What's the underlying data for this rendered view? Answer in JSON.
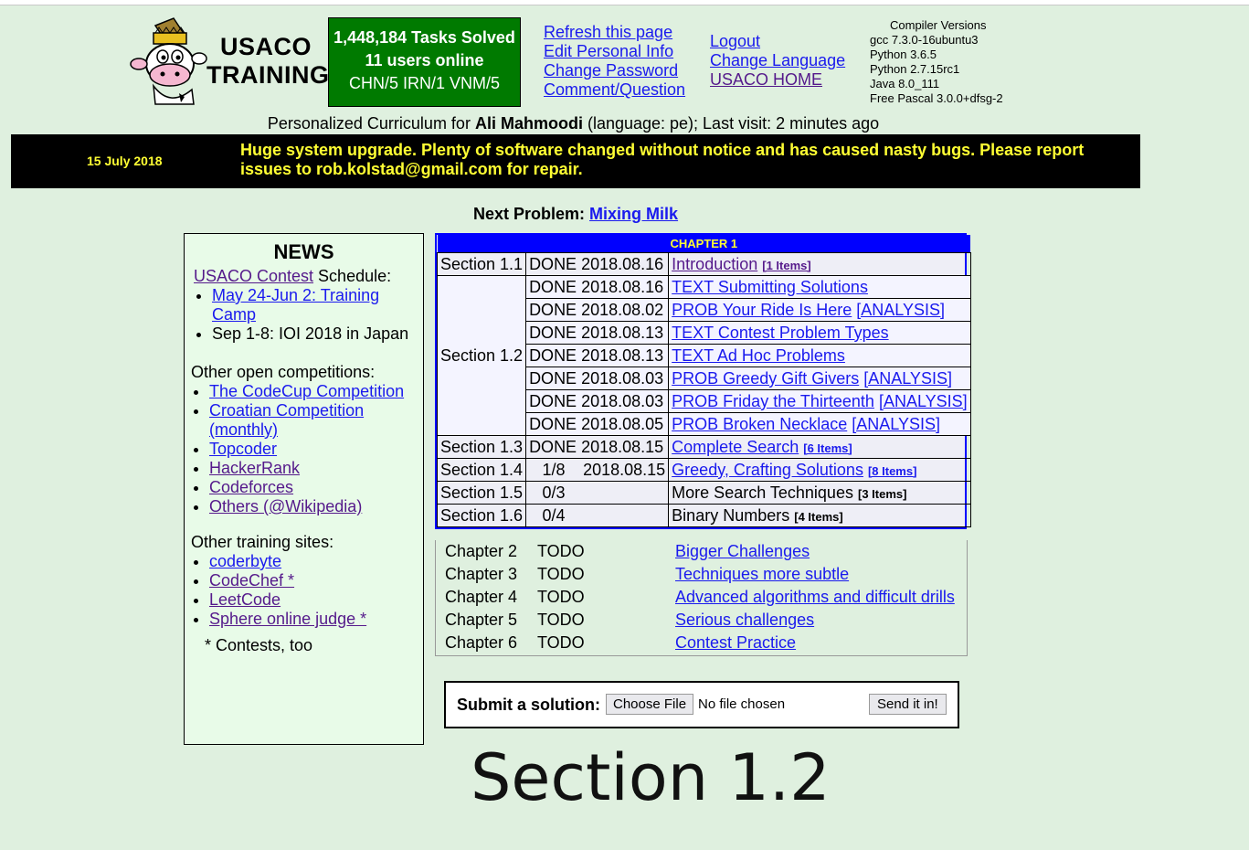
{
  "logo": {
    "line1": "USACO",
    "line2": "TRAINING"
  },
  "stats": {
    "tasks": "1,448,184 Tasks Solved",
    "users": "11 users online",
    "countries": "CHN/5 IRN/1 VNM/5"
  },
  "links_left": [
    "Refresh this page",
    "Edit Personal Info",
    "Change Password",
    "Comment/Question"
  ],
  "links_right": [
    "Logout",
    "Change Language",
    "USACO HOME"
  ],
  "compiler": {
    "title": "Compiler Versions",
    "versions": [
      "gcc 7.3.0-16ubuntu3",
      "Python 3.6.5",
      "Python 2.7.15rc1",
      "Java 8.0_111",
      "Free Pascal 3.0.0+dfsg-2"
    ]
  },
  "curriculum": {
    "prefix": "Personalized Curriculum for ",
    "name": "Ali Mahmoodi",
    "suffix": " (language: pe); Last visit: 2 minutes ago"
  },
  "banner": {
    "date": "15 July 2018",
    "message": "Huge system upgrade. Plenty of software changed without notice and has caused nasty bugs. Please report issues to rob.kolstad@gmail.com for repair."
  },
  "next_problem": {
    "label": "Next Problem:",
    "link": "Mixing Milk"
  },
  "news": {
    "title": "NEWS",
    "contest_link": "USACO Contest",
    "contest_suffix": " Schedule:",
    "schedule_link": "May 24-Jun 2: Training Camp",
    "schedule_text": "Sep 1-8: IOI 2018 in Japan",
    "open_title": "Other open competitions:",
    "open_links": [
      "The CodeCup Competition",
      "Croatian Competition (monthly)",
      "Topcoder",
      "HackerRank",
      "Codeforces",
      "Others (@Wikipedia)"
    ],
    "training_title": "Other training sites:",
    "training_links": [
      "coderbyte",
      "CodeChef *",
      "LeetCode",
      "Sphere online judge *"
    ],
    "footnote": "* Contests, too"
  },
  "chapter1": {
    "header": "CHAPTER 1",
    "s11": {
      "section": "Section 1.1",
      "status": "DONE 2018.08.16",
      "title": "Introduction",
      "items": "[1 Items]"
    },
    "s12": {
      "section": "Section 1.2",
      "rows": [
        {
          "status": "DONE 2018.08.16",
          "title": "TEXT Submitting Solutions",
          "analysis": ""
        },
        {
          "status": "DONE 2018.08.02",
          "title": "PROB Your Ride Is Here",
          "analysis": "[ANALYSIS]"
        },
        {
          "status": "DONE 2018.08.13",
          "title": "TEXT Contest Problem Types",
          "analysis": ""
        },
        {
          "status": "DONE 2018.08.13",
          "title": "TEXT Ad Hoc Problems",
          "analysis": ""
        },
        {
          "status": "DONE 2018.08.03",
          "title": "PROB Greedy Gift Givers",
          "analysis": "[ANALYSIS]"
        },
        {
          "status": "DONE 2018.08.03",
          "title": "PROB Friday the Thirteenth",
          "analysis": "[ANALYSIS]"
        },
        {
          "status": "DONE 2018.08.05",
          "title": "PROB Broken Necklace",
          "analysis": "[ANALYSIS]"
        }
      ]
    },
    "s13": {
      "section": "Section 1.3",
      "status": "DONE 2018.08.15",
      "title": "Complete Search",
      "items": "[6 Items]"
    },
    "s14": {
      "section": "Section 1.4",
      "progress": "1/8",
      "date": "2018.08.15",
      "title": "Greedy, Crafting Solutions",
      "items": "[8 Items]"
    },
    "s15": {
      "section": "Section 1.5",
      "progress": "0/3",
      "title": "More Search Techniques",
      "items": "[3 Items]"
    },
    "s16": {
      "section": "Section 1.6",
      "progress": "0/4",
      "title": "Binary Numbers",
      "items": "[4 Items]"
    }
  },
  "chapters": [
    {
      "name": "Chapter 2",
      "status": "TODO",
      "title": "Bigger Challenges"
    },
    {
      "name": "Chapter 3",
      "status": "TODO",
      "title": "Techniques more subtle"
    },
    {
      "name": "Chapter 4",
      "status": "TODO",
      "title": "Advanced algorithms and difficult drills"
    },
    {
      "name": "Chapter 5",
      "status": "TODO",
      "title": "Serious challenges"
    },
    {
      "name": "Chapter 6",
      "status": "TODO",
      "title": "Contest Practice"
    }
  ],
  "submit": {
    "label": "Submit a solution:",
    "choose": "Choose File",
    "nofile": "No file chosen",
    "send": "Send it in!"
  },
  "overlay": "Section 1.2"
}
